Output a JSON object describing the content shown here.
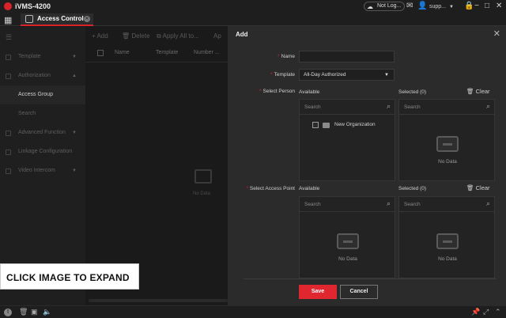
{
  "app": {
    "title": "iVMS-4200"
  },
  "titlebar": {
    "cloud_status": "Not Log...",
    "user": "supp...",
    "home_icon": "grid-icon"
  },
  "tabs": [
    {
      "label": "Access Control"
    }
  ],
  "sidebar": {
    "items": [
      {
        "label": "Template",
        "expandable": true
      },
      {
        "label": "Authorization",
        "expandable": true
      },
      {
        "label": "Access Group",
        "expandable": false
      },
      {
        "label": "Search",
        "expandable": false
      },
      {
        "label": "Advanced Function",
        "expandable": true
      },
      {
        "label": "Linkage Configuration",
        "expandable": false
      },
      {
        "label": "Video Intercom",
        "expandable": true
      }
    ]
  },
  "content": {
    "toolbar": {
      "add": "Add",
      "delete": "Delete",
      "apply_all": "Apply All to...",
      "more": "Ap"
    },
    "table_headers": [
      "Name",
      "Template",
      "Number ..."
    ],
    "no_data": "No Data"
  },
  "dialog": {
    "title": "Add",
    "name_label": "Name",
    "name_value": "",
    "template_label": "Template",
    "template_value": "All-Day Authorized",
    "select_person_label": "Select Person",
    "select_access_point_label": "Select Access Point",
    "available_label": "Available",
    "selected_label": "Selected  (0)",
    "clear_label": "Clear",
    "search_placeholder": "Search",
    "tree_item": "New Organization",
    "no_data": "No Data",
    "save": "Save",
    "cancel": "Cancel"
  },
  "overlay": {
    "expand_text": "CLICK IMAGE TO EXPAND"
  },
  "colors": {
    "accent": "#e0262f",
    "dialog_bg": "#2b2b2b",
    "app_bg": "#1a1a1a"
  }
}
